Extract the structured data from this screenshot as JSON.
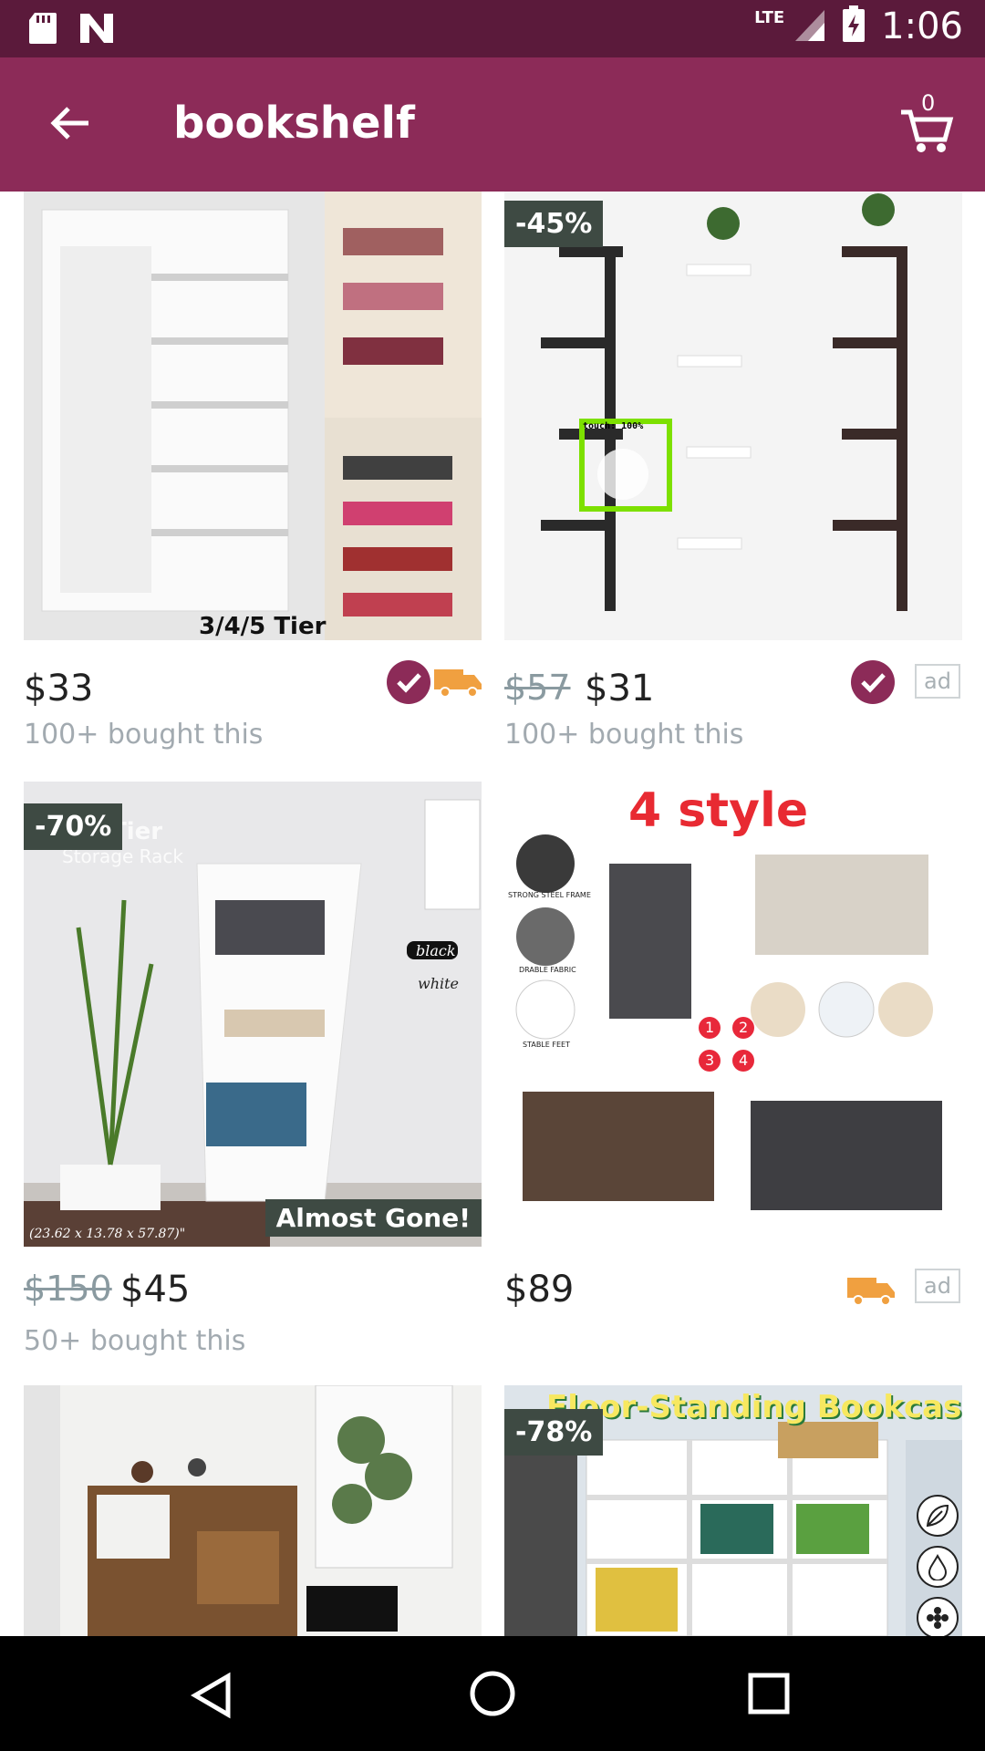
{
  "status_bar": {
    "time": "1:06",
    "network": "LTE",
    "icons": [
      "sd-card-icon",
      "n-icon",
      "signal-icon",
      "battery-charging-icon"
    ]
  },
  "app_bar": {
    "title": "bookshelf",
    "cart_count": "0",
    "back_icon": "arrow-left-icon",
    "cart_icon": "shopping-cart-icon"
  },
  "colors": {
    "status_bar": "#5b1a3b",
    "app_bar": "#8c2b58",
    "accent": "#8c2b58",
    "truck": "#f0a040"
  },
  "products": [
    {
      "price": "$33",
      "bought": "100+ bought this",
      "image_caption": "3/4/5 Tier"
    },
    {
      "discount": "-45%",
      "old_price": "$57",
      "price": "$31",
      "bought": "100+ bought this",
      "ad": "ad",
      "overlay": "touch: 100%"
    },
    {
      "discount": "-70%",
      "old_price": "$150",
      "price": "$45",
      "bought": "50+ bought this",
      "image_caption": "Almost Gone!",
      "image_text": {
        "rack": "Storage Rack",
        "tier": "Tier",
        "black": "black",
        "white": "white",
        "size": "(23.62 x 13.78 x 57.87)\""
      }
    },
    {
      "price": "$89",
      "ad": "ad",
      "image_title": "4 style",
      "labels": [
        "STRONG STEEL FRAME",
        "DRABLE FABRIC",
        "STABLE FEET"
      ],
      "numbers": [
        "1",
        "2",
        "3",
        "4"
      ]
    },
    {},
    {
      "discount": "-78%",
      "image_title": "Floor-Standing Bookcase"
    }
  ]
}
